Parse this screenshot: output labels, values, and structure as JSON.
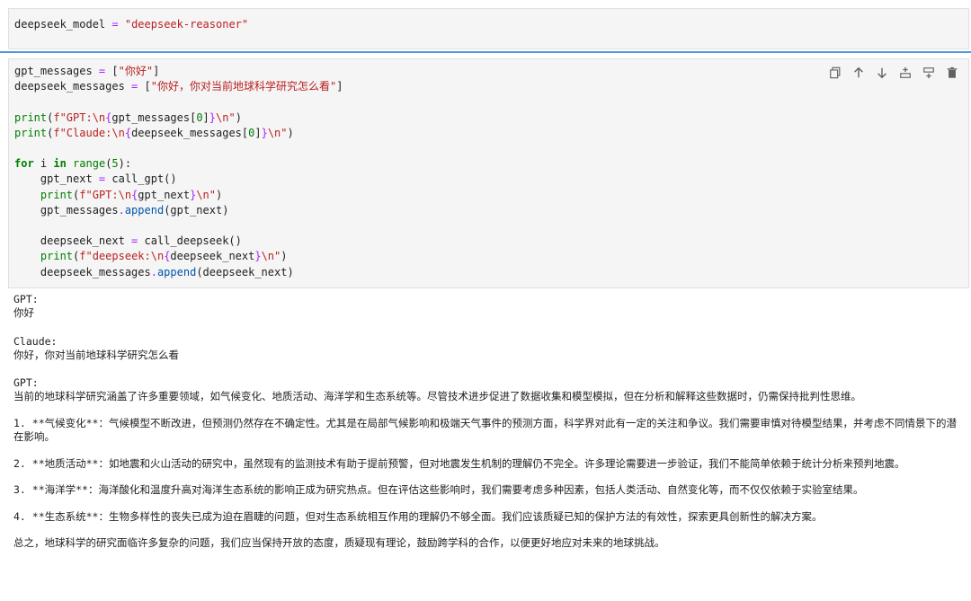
{
  "cell_top": {
    "var": "deepseek_model",
    "op": " = ",
    "value": "\"deepseek-reasoner\""
  },
  "toolbar": {
    "icons": [
      "duplicate-icon",
      "move-up-icon",
      "move-down-icon",
      "insert-above-icon",
      "insert-below-icon",
      "delete-icon"
    ]
  },
  "code": {
    "l1_a": "gpt_messages ",
    "l1_b": "=",
    "l1_c": " [",
    "l1_d": "\"你好\"",
    "l1_e": "]",
    "l2_a": "deepseek_messages ",
    "l2_b": "=",
    "l2_c": " [",
    "l2_d": "\"你好，你对当前地球科学研究怎么看\"",
    "l2_e": "]",
    "l4_a": "print",
    "l4_b": "(",
    "l4_c": "f\"GPT:\\n",
    "l4_d": "{",
    "l4_e": "gpt_messages[",
    "l4_f": "0",
    "l4_g": "]",
    "l4_h": "}",
    "l4_i": "\\n\"",
    "l4_j": ")",
    "l5_a": "print",
    "l5_b": "(",
    "l5_c": "f\"Claude:\\n",
    "l5_d": "{",
    "l5_e": "deepseek_messages[",
    "l5_f": "0",
    "l5_g": "]",
    "l5_h": "}",
    "l5_i": "\\n\"",
    "l5_j": ")",
    "l7_for": "for",
    "l7_i": " i ",
    "l7_in": "in",
    "l7_range": " range",
    "l7_b": "(",
    "l7_n": "5",
    "l7_c": "):",
    "l8_a": "    gpt_next ",
    "l8_b": "=",
    "l8_c": " call_gpt()",
    "l9_a": "    ",
    "l9_print": "print",
    "l9_b": "(",
    "l9_c": "f\"GPT:\\n",
    "l9_d": "{",
    "l9_e": "gpt_next",
    "l9_f": "}",
    "l9_g": "\\n\"",
    "l9_h": ")",
    "l10_a": "    gpt_messages",
    "l10_b": ".",
    "l10_c": "append",
    "l10_d": "(gpt_next)",
    "l12_a": "    deepseek_next ",
    "l12_b": "=",
    "l12_c": " call_deepseek()",
    "l13_a": "    ",
    "l13_print": "print",
    "l13_b": "(",
    "l13_c": "f\"deepseek:\\n",
    "l13_d": "{",
    "l13_e": "deepseek_next",
    "l13_f": "}",
    "l13_g": "\\n\"",
    "l13_h": ")",
    "l14_a": "    deepseek_messages",
    "l14_b": ".",
    "l14_c": "append",
    "l14_d": "(deepseek_next)"
  },
  "output": {
    "gpt_label_1": "GPT:",
    "gpt_msg_1": "你好",
    "claude_label": "Claude:",
    "claude_msg": "你好，你对当前地球科学研究怎么看",
    "gpt_label_2": "GPT:",
    "intro": "当前的地球科学研究涵盖了许多重要领域，如气候变化、地质活动、海洋学和生态系统等。尽管技术进步促进了数据收集和模型模拟，但在分析和解释这些数据时，仍需保持批判性思维。",
    "p1_num": "1. **",
    "p1_head": "气候变化",
    "p1_sep": "**：",
    "p1_body": "气候模型不断改进，但预测仍然存在不确定性。尤其是在局部气候影响和极端天气事件的预测方面，科学界对此有一定的关注和争议。我们需要审慎对待模型结果，并考虑不同情景下的潜在影响。",
    "p2_num": "2. **",
    "p2_head": "地质活动",
    "p2_sep": "**：",
    "p2_body": "如地震和火山活动的研究中，虽然现有的监测技术有助于提前预警，但对地震发生机制的理解仍不完全。许多理论需要进一步验证，我们不能简单依赖于统计分析来预判地震。",
    "p3_num": "3. **",
    "p3_head": "海洋学",
    "p3_sep": "**：",
    "p3_body": "海洋酸化和温度升高对海洋生态系统的影响正成为研究热点。但在评估这些影响时，我们需要考虑多种因素，包括人类活动、自然变化等，而不仅仅依赖于实验室结果。",
    "p4_num": "4. **",
    "p4_head": "生态系统",
    "p4_sep": "**：",
    "p4_body": "生物多样性的丧失已成为迫在眉睫的问题，但对生态系统相互作用的理解仍不够全面。我们应该质疑已知的保护方法的有效性，探索更具创新性的解决方案。",
    "summary": "总之，地球科学的研究面临许多复杂的问题，我们应当保持开放的态度，质疑现有理论，鼓励跨学科的合作，以便更好地应对未来的地球挑战。"
  }
}
